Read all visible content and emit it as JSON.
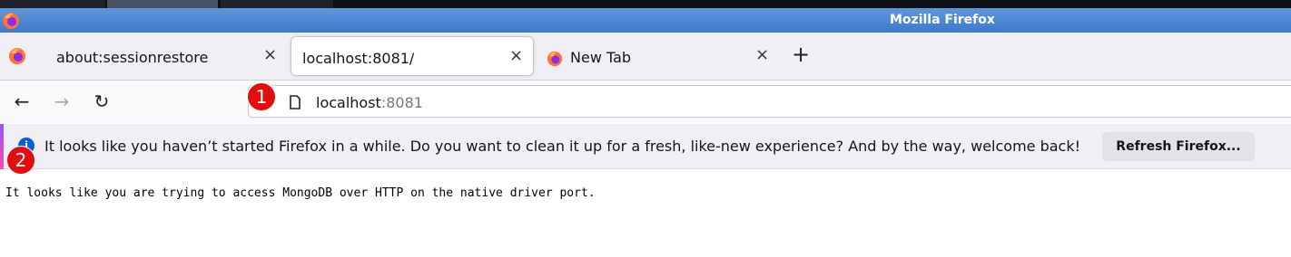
{
  "window": {
    "title": "Mozilla Firefox"
  },
  "tabs": [
    {
      "label": "about:sessionrestore",
      "close_glyph": "×",
      "selected": false,
      "icon": "firefox-icon"
    },
    {
      "label": "localhost:8081/",
      "close_glyph": "×",
      "selected": true,
      "icon": "none"
    },
    {
      "label": "New Tab",
      "close_glyph": "×",
      "selected": false,
      "icon": "firefox-icon"
    }
  ],
  "tabstrip": {
    "new_tab_glyph": "+"
  },
  "nav": {
    "back_glyph": "←",
    "forward_glyph": "→",
    "reload_glyph": "↻"
  },
  "urlbar": {
    "host": "localhost",
    "port": ":8081",
    "icon": "page-icon"
  },
  "notification": {
    "icon_glyph": "i",
    "message": "It looks like you haven’t started Firefox in a while. Do you want to clean it up for a fresh, like-new experience? And by the way, welcome back!",
    "button_label": "Refresh Firefox..."
  },
  "page": {
    "text": "It looks like you are trying to access MongoDB over HTTP on the native driver port."
  },
  "markers": [
    "1",
    "2"
  ],
  "colors": {
    "titlebar": "#3e79c9",
    "marker": "#e30d0d",
    "info": "#0060df"
  }
}
